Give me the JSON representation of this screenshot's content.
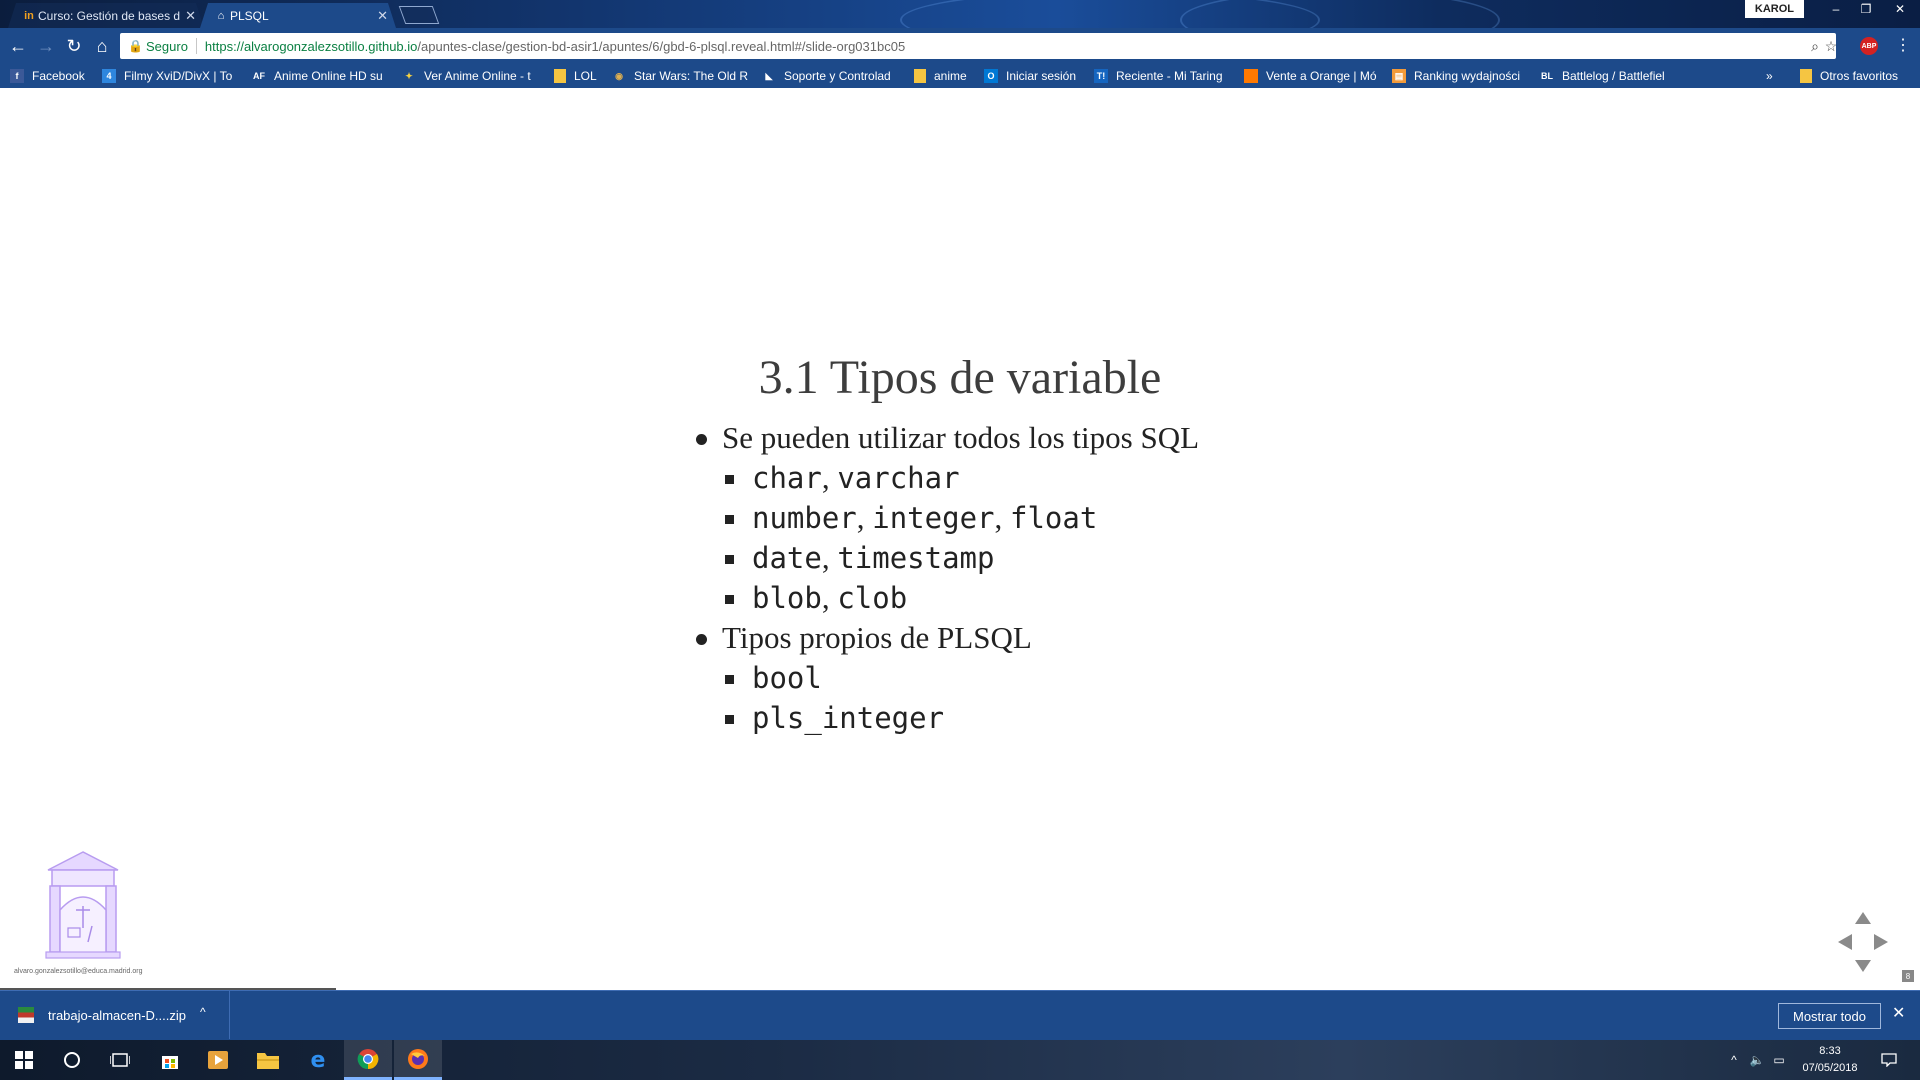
{
  "browser": {
    "tabs": [
      {
        "title": "Curso: Gestión de bases d",
        "favicon": "in"
      },
      {
        "title": "PLSQL",
        "favicon": "⌂"
      }
    ],
    "profile": "KAROL",
    "window_controls": {
      "minimize": "–",
      "restore": "❐",
      "close": "✕"
    },
    "address": {
      "secure_label": "Seguro",
      "url_host": "https://alvarogonzalezsotillo.github.io",
      "url_path": "/apuntes-clase/gestion-bd-asir1/apuntes/6/gbd-6-plsql.reveal.html#/slide-org031bc05"
    },
    "abp_label": "ABP",
    "bookmarks": [
      {
        "label": "Facebook",
        "icon": "f"
      },
      {
        "label": "Filmy XviD/DivX | To",
        "icon": "4"
      },
      {
        "label": "Anime Online HD su",
        "icon": "AF"
      },
      {
        "label": "Ver Anime Online - t",
        "icon": "✦"
      },
      {
        "label": "LOL",
        "icon": ""
      },
      {
        "label": "Star Wars: The Old R",
        "icon": "◉"
      },
      {
        "label": "Soporte y Controlad",
        "icon": "◣"
      },
      {
        "label": "anime",
        "icon": ""
      },
      {
        "label": "Iniciar sesión",
        "icon": "O"
      },
      {
        "label": "Reciente - Mi Taring",
        "icon": "T!"
      },
      {
        "label": "Vente a Orange | Mó",
        "icon": ""
      },
      {
        "label": "Ranking wydajności",
        "icon": "▤"
      },
      {
        "label": "Battlelog / Battlefiel",
        "icon": "BL"
      }
    ],
    "bookmarks_overflow": "»",
    "other_bookmarks": "Otros favoritos"
  },
  "slide": {
    "title": "3.1 Tipos de variable",
    "items": [
      {
        "text": "Se pueden utilizar todos los tipos SQL",
        "sub": [
          [
            "char",
            "varchar"
          ],
          [
            "number",
            "integer",
            "float"
          ],
          [
            "date",
            "timestamp"
          ],
          [
            "blob",
            "clob"
          ]
        ]
      },
      {
        "text": "Tipos propios de PLSQL",
        "sub": [
          [
            "bool"
          ],
          [
            "pls_integer"
          ]
        ]
      }
    ],
    "footer_email": "alvaro.gonzalezsotillo@educa.madrid.org",
    "slide_number": "8",
    "progress_fraction": 0.175
  },
  "downloads": {
    "file": "trabajo-almacen-D....zip",
    "show_all": "Mostrar todo"
  },
  "taskbar": {
    "time": "8:33",
    "date": "07/05/2018"
  }
}
